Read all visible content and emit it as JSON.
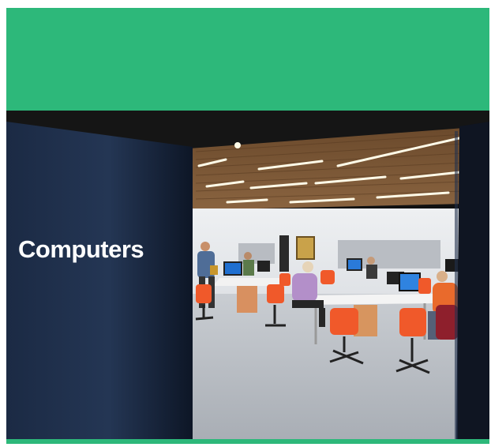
{
  "banner": {
    "color": "#2db87a"
  },
  "photo": {
    "sign_text": "Computers"
  }
}
